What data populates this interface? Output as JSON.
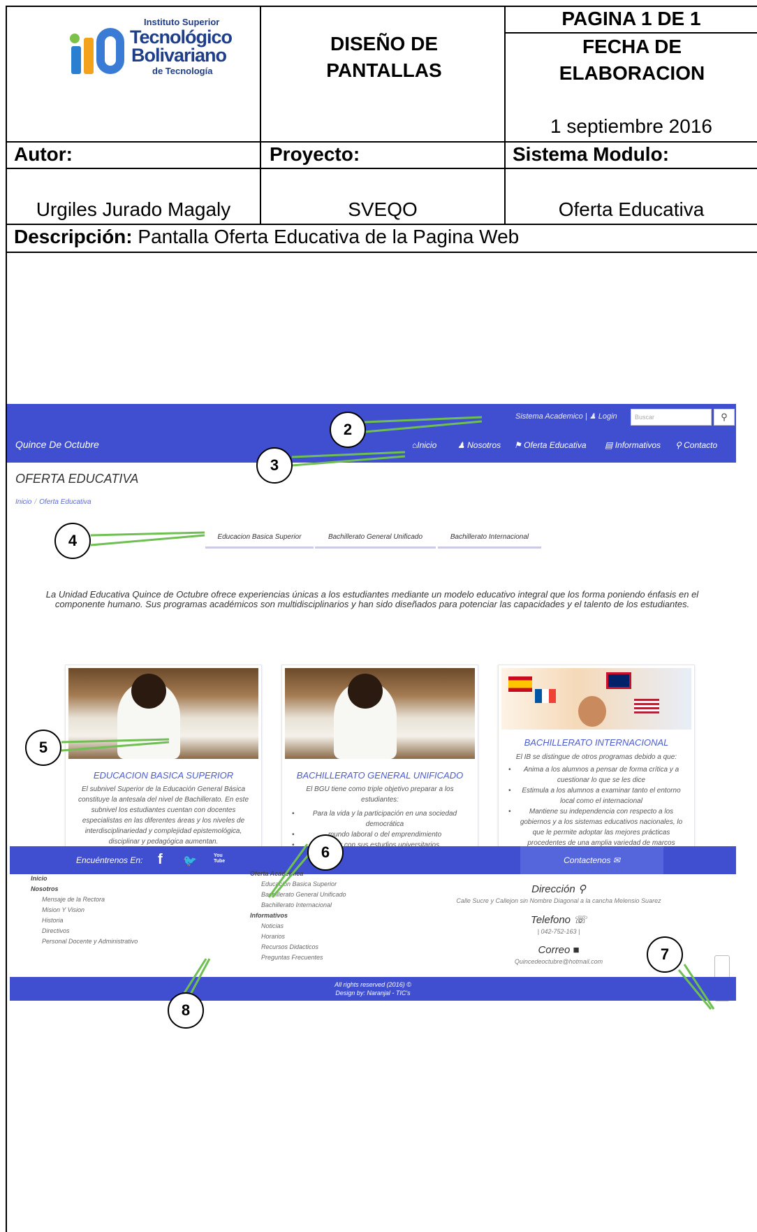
{
  "header": {
    "logo": {
      "line1": "Instituto Superior",
      "line2": "Tecnológico",
      "line3": "Bolivariano",
      "line4": "de Tecnología",
      "mark": "itb"
    },
    "doc_title": "DISEÑO DE PANTALLAS",
    "page": "PAGINA 1 DE 1",
    "date_label": "FECHA DE ELABORACION",
    "date_value": "1 septiembre 2016",
    "author_label": "Autor:",
    "author_value": "Urgiles Jurado Magaly",
    "project_label": "Proyecto:",
    "project_value": "SVEQO",
    "module_label": "Sistema Modulo:",
    "module_value": "Oferta Educativa",
    "description_label": "Descripción:",
    "description_value": " Pantalla Oferta Educativa de la Pagina Web"
  },
  "site": {
    "brand": "Quince De Octubre",
    "top_links": "Sistema Academico |",
    "login": "Login",
    "search_placeholder": "Buscar",
    "nav": [
      {
        "label": "Inicio",
        "icon": "home-icon"
      },
      {
        "label": "Nosotros",
        "icon": "user-icon"
      },
      {
        "label": "Oferta Educativa",
        "icon": "graduation-cap-icon"
      },
      {
        "label": "Informativos",
        "icon": "newspaper-icon"
      },
      {
        "label": "Contacto",
        "icon": "map-marker-icon"
      }
    ],
    "page_title": "OFERTA EDUCATIVA",
    "breadcrumb": [
      "Inicio",
      "Oferta Educativa"
    ],
    "tabs": [
      "Educacion Basica Superior",
      "Bachillerato General Unificado",
      "Bachillerato Internacional"
    ],
    "intro": "La Unidad Educativa Quince de Octubre ofrece experiencias únicas a los estudiantes mediante un modelo educativo integral que los forma poniendo énfasis en el componente humano. Sus programas académicos son multidisciplinarios y han sido diseñados para potenciar las capacidades y el talento de los estudiantes.",
    "cards": [
      {
        "title": "EDUCACION BASICA SUPERIOR",
        "text": "El subnivel Superior de la Educación General Básica constituye la antesala del nivel de Bachillerato. En este subnivel los estudiantes cuentan con docentes especialistas en las diferentes áreas y los niveles de interdisciplinariedad y complejidad epistemológica, disciplinar y pedagógica aumentan."
      },
      {
        "title": "BACHILLERATO GENERAL UNIFICADO",
        "text": "El BGU tiene como triple objetivo preparar a los estudiantes:",
        "bullets": [
          "Para la vida y la participación en una sociedad democrática",
          "mundo laboral o del emprendimiento",
          "nuar con sus estudios universitarios."
        ]
      },
      {
        "title": "BACHILLERATO INTERNACIONAL",
        "text": "El IB se distingue de otros programas debido a que:",
        "bullets": [
          "Anima a los alumnos a pensar de forma crítica y a cuestionar lo que se les dice",
          "Estimula a los alumnos a examinar tanto el entorno local como el internacional",
          "Mantiene su independencia con respecto a los gobiernos y a los sistemas educativos nacionales, lo que le permite adoptar las mejores prácticas procedentes de una amplia variedad de marcos educativos y currículos de distintos países"
        ]
      }
    ],
    "footer": {
      "find_us": "Encuéntrenos En:",
      "social": [
        "f",
        "🐦",
        "You Tube"
      ],
      "contact_tab": "Contactenos ✉",
      "col1": {
        "h1": "Inicio",
        "h2": "Nosotros",
        "items": [
          "Mensaje de la Rectora",
          "Mision Y Vision",
          "Historia",
          "Directivos",
          "Personal Docente y Administrativo"
        ]
      },
      "col2": {
        "h1": "Oferta Academica",
        "items1": [
          "Educacion Basica Superior",
          "Bachillerato General Unificado",
          "Bachillerato Internacional"
        ],
        "h2": "Informativos",
        "items2": [
          "Noticias",
          "Horarios",
          "Recursos Didacticos",
          "Preguntas Frecuentes"
        ]
      },
      "address_label": "Dirección",
      "address_value": "Calle Sucre y Callejon sin Nombre Diagonal a la cancha Melensio Suarez",
      "phone_label": "Telefono",
      "phone_value": "| 042-752-163 |",
      "email_label": "Correo",
      "email_value": "Quincedeoctubre@hotmail.com",
      "copyright1": "All rights reserved (2016) ©",
      "copyright2": "Design by: Naranjal - TIC's"
    }
  },
  "callouts": [
    "2",
    "3",
    "4",
    "5",
    "6",
    "7",
    "8"
  ]
}
